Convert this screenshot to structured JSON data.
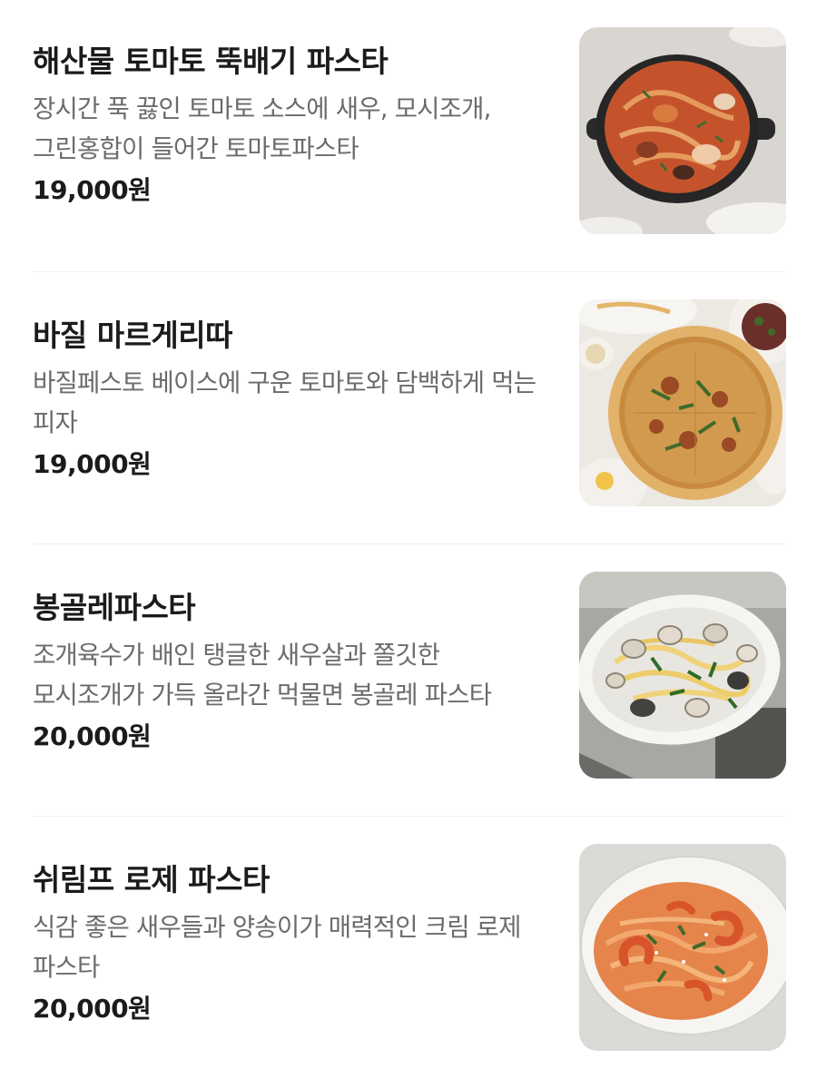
{
  "menu": {
    "items": [
      {
        "name": "해산물 토마토 뚝배기 파스타",
        "description": "장시간 푹 끓인 토마토 소스에 새우, 모시조개, 그린홍합이 들어간 토마토파스타",
        "price": "19,000원",
        "photo": "seafood-tomato-pasta-photo"
      },
      {
        "name": "바질 마르게리따",
        "description": "바질페스토 베이스에 구운 토마토와 담백하게 먹는 피자",
        "price": "19,000원",
        "photo": "basil-margherita-pizza-photo"
      },
      {
        "name": "봉골레파스타",
        "description": "조개육수가 배인 탱글한 새우살과 쫄깃한 모시조개가 가득 올라간 먹물면 봉골레 파스타",
        "price": "20,000원",
        "photo": "vongole-pasta-photo"
      },
      {
        "name": "쉬림프 로제 파스타",
        "description": "식감 좋은 새우들과 양송이가 매력적인 크림 로제 파스타",
        "price": "20,000원",
        "photo": "shrimp-rose-pasta-photo"
      }
    ]
  }
}
